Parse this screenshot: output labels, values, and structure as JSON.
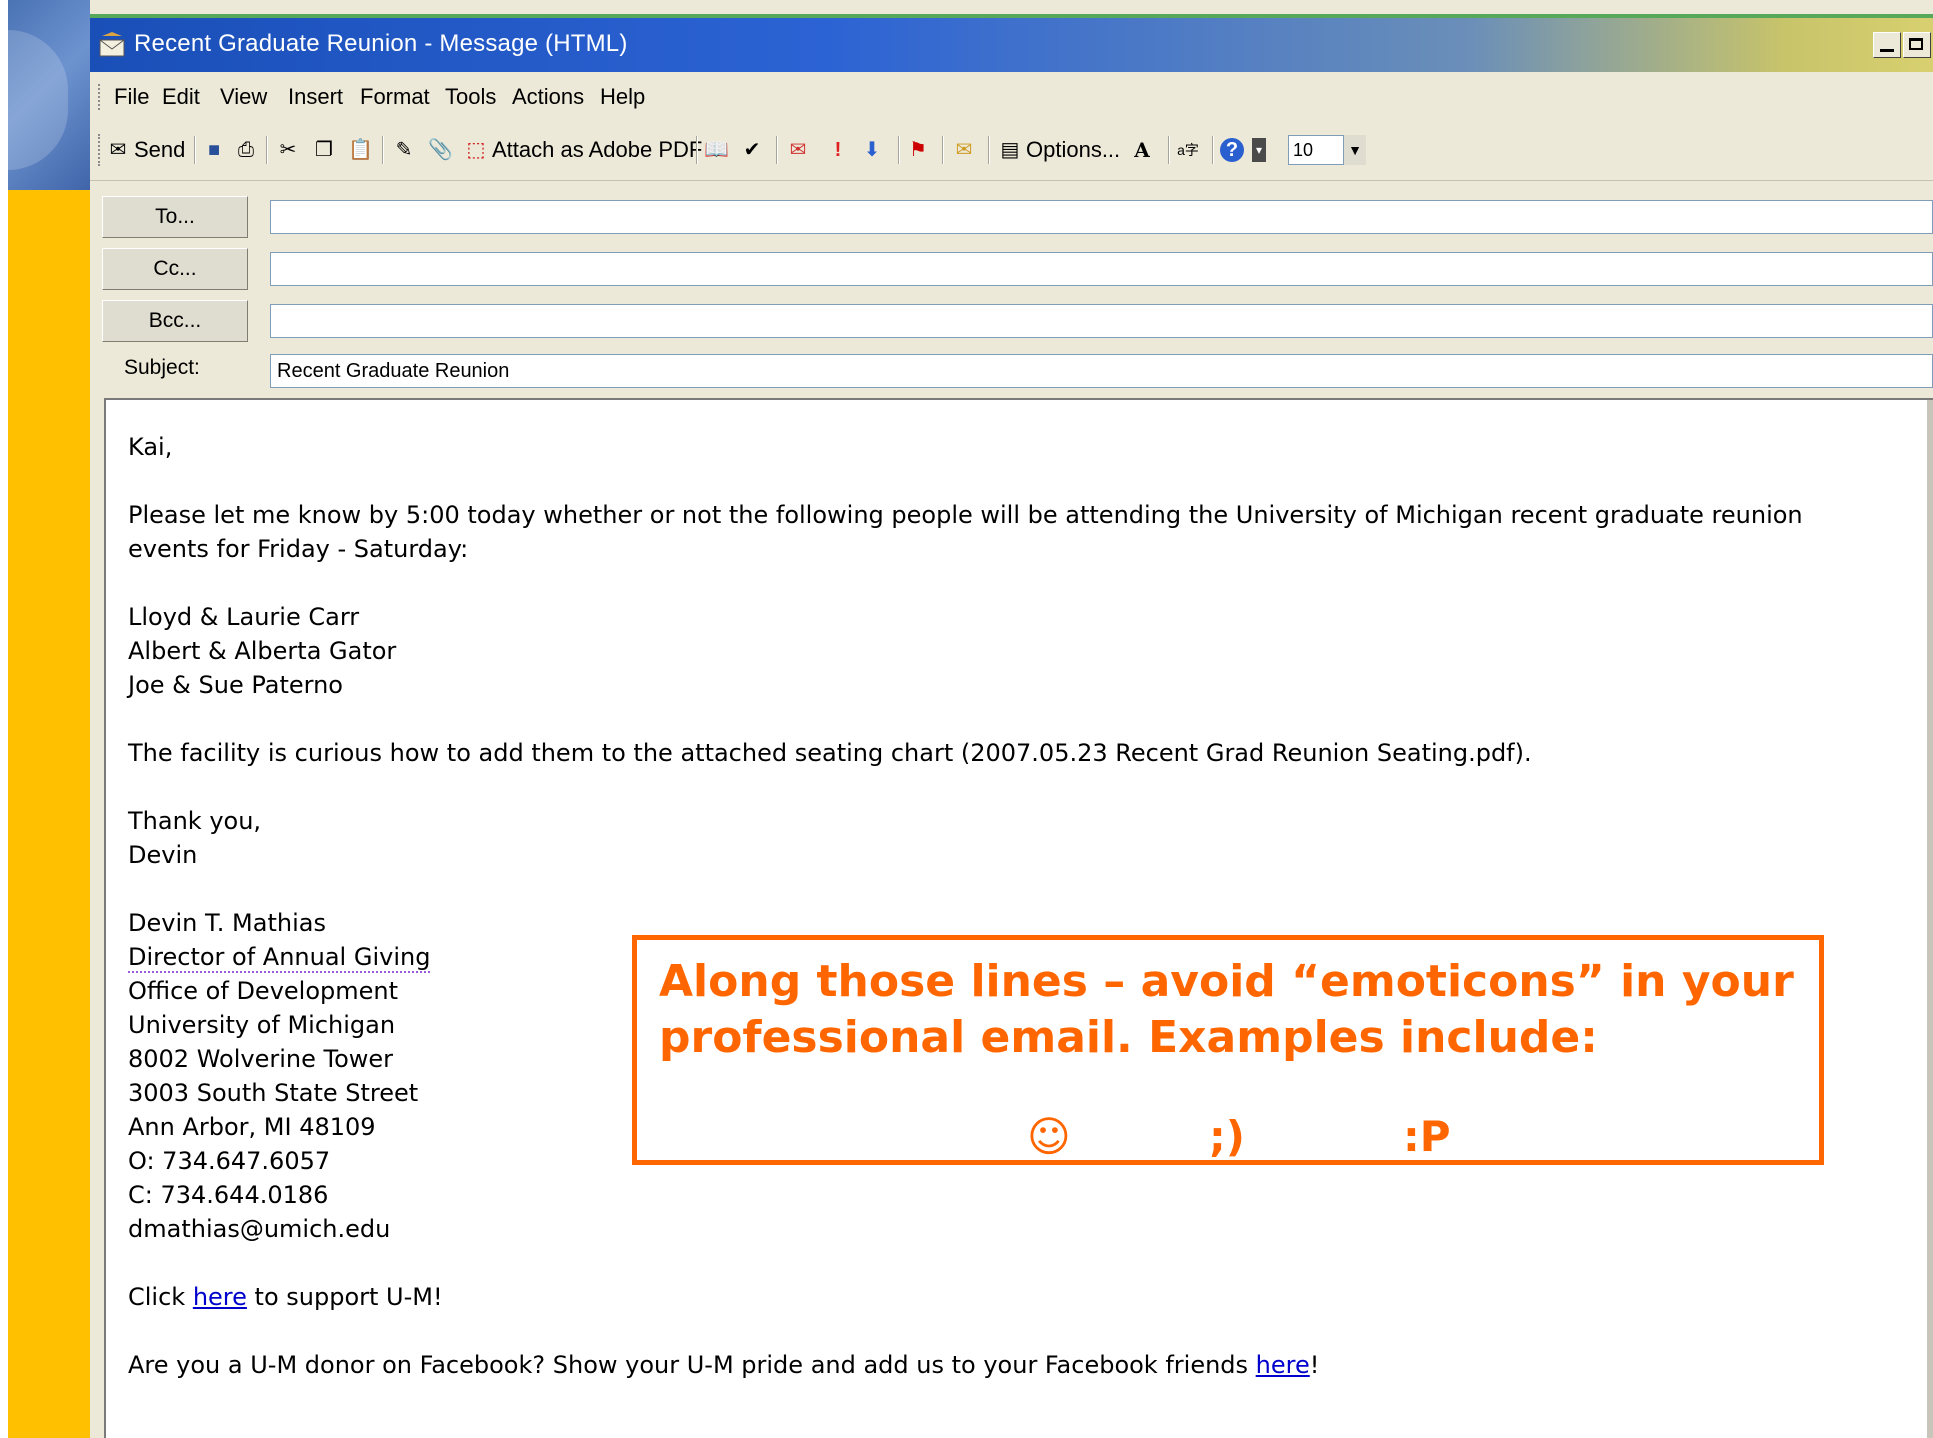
{
  "window": {
    "title": "Recent Graduate Reunion - Message (HTML)"
  },
  "menu": {
    "file": "File",
    "edit": "Edit",
    "view": "View",
    "insert": "Insert",
    "format": "Format",
    "tools": "Tools",
    "actions": "Actions",
    "help": "Help"
  },
  "toolbar": {
    "send": "Send",
    "attach_pdf": "Attach as Adobe PDF",
    "options": "Options...",
    "font_size": "10"
  },
  "header": {
    "to_label": "To...",
    "cc_label": "Cc...",
    "bcc_label": "Bcc...",
    "subject_label": "Subject:",
    "to_value": "",
    "cc_value": "",
    "bcc_value": "",
    "subject_value": "Recent Graduate Reunion"
  },
  "body": {
    "greeting": "Kai,",
    "paragraph1": "Please let me know by 5:00 today whether or not the following people will be attending the University of Michigan recent graduate reunion events for Friday - Saturday:",
    "people": [
      "Lloyd & Laurie Carr",
      "Albert & Alberta Gator",
      "Joe & Sue Paterno"
    ],
    "paragraph2": "The facility is curious how to add them to the attached seating chart (2007.05.23 Recent Grad Reunion Seating.pdf).",
    "closing": "Thank you,",
    "closing_name": "Devin",
    "signature": {
      "name": "Devin T. Mathias",
      "title": "Director of Annual Giving",
      "office": "Office of Development",
      "university": "University of Michigan",
      "address1": "8002 Wolverine Tower",
      "address2": "3003 South State Street",
      "city": "Ann Arbor, MI 48109",
      "office_phone": "O: 734.647.6057",
      "cell_phone": "C: 734.644.0186",
      "email": "dmathias@umich.edu"
    },
    "support_prefix": "Click ",
    "support_link": "here",
    "support_suffix": " to support U-M!",
    "facebook_prefix": "Are you a U-M donor on Facebook?  Show your U-M pride and add us to your Facebook friends ",
    "facebook_link": "here",
    "facebook_suffix": "!"
  },
  "callout": {
    "message": "Along those lines – avoid “emoticons” in your professional email. Examples include:",
    "emoticons": [
      "☺",
      ";)",
      ":P"
    ]
  },
  "colors": {
    "accent": "#FF6600",
    "slide_yellow": "#FFC000",
    "titlebar_blue": "#2c63d4"
  }
}
